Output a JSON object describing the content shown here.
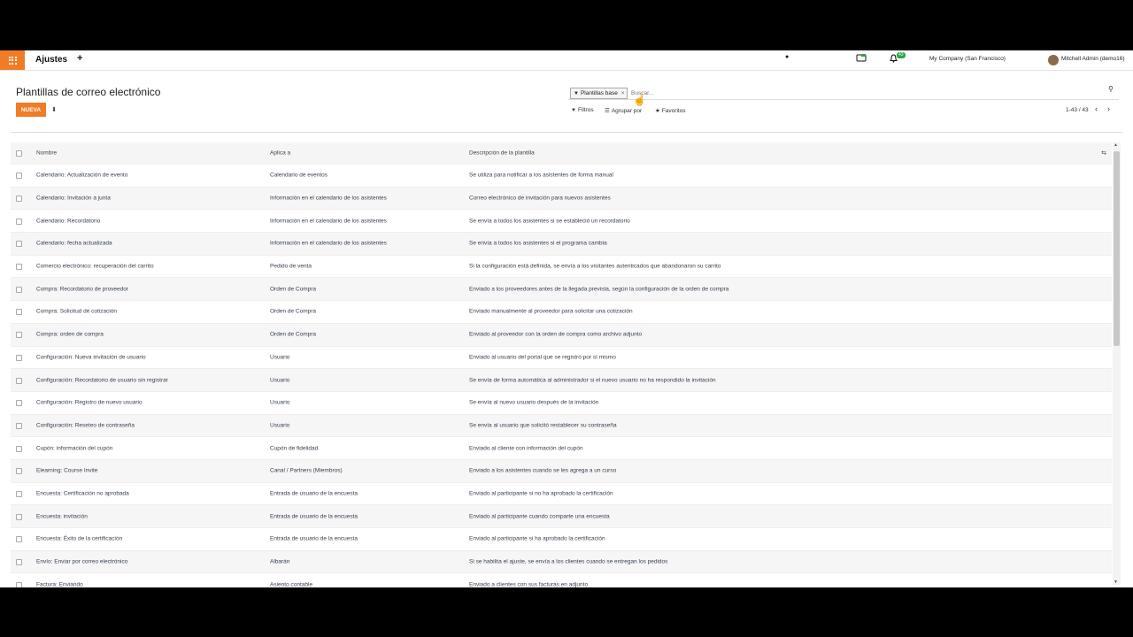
{
  "navbar": {
    "app_title": "Ajustes",
    "plus_label": "+",
    "messages_badge": "",
    "activity_badge": "43",
    "company": "My Company (San Francisco)",
    "user": "Mitchell Admin (demo16)"
  },
  "page": {
    "title": "Plantillas de correo electrónico",
    "new_button": "NUEVA"
  },
  "search": {
    "facet_label": "Plantillas base",
    "placeholder": "Buscar...",
    "filters": "Filtros",
    "group_by": "Agrupar por",
    "favorites": "Favoritos",
    "pager": "1-43 / 43"
  },
  "table": {
    "headers": [
      "Nombre",
      "Aplica a",
      "Descripción de la plantilla"
    ],
    "rows": [
      [
        "Calendario: Actualización de evento",
        "Calendario de eventos",
        "Se utiliza para notificar a los asistentes de forma manual"
      ],
      [
        "Calendario: Invitación a junta",
        "Información en el calendario de los asistentes",
        "Correo electrónico de invitación para nuevos asistentes"
      ],
      [
        "Calendario: Recordatorio",
        "Información en el calendario de los asistentes",
        "Se envía a todos los asistentes si se estableció un recordatorio"
      ],
      [
        "Calendario: fecha actualizada",
        "Información en el calendario de los asistentes",
        "Se envía a todos los asistentes si el programa cambia"
      ],
      [
        "Comercio electrónico: recuperación del carrito",
        "Pedido de venta",
        "Si la configuración está definida, se envía a los visitantes autenticados que abandonaron su carrito"
      ],
      [
        "Compra: Recordatorio de proveedor",
        "Orden de Compra",
        "Enviado a los proveedores antes de la llegada prevista, según la configuración de la orden de compra"
      ],
      [
        "Compra: Solicitud de cotización",
        "Orden de Compra",
        "Enviado manualmente al proveedor para solicitar una cotización"
      ],
      [
        "Compra: orden de compra",
        "Orden de Compra",
        "Enviado al proveedor con la orden de compra como archivo adjunto"
      ],
      [
        "Configuración: Nueva invitación de usuario",
        "Usuario",
        "Enviado al usuario del portal que se registró por sí mismo"
      ],
      [
        "Configuración: Recordatorio de usuario sin registrar",
        "Usuario",
        "Se envía de forma automática al administrador si el nuevo usuario no ha respondido la invitación"
      ],
      [
        "Configuración: Registro de nuevo usuario",
        "Usuario",
        "Se envía al nuevo usuario después de la invitación"
      ],
      [
        "Configuración: Reseteo de contraseña",
        "Usuario",
        "Se envía al usuario que solicitó restablecer su contraseña"
      ],
      [
        "Cupón: información del cupón",
        "Cupón de fidelidad",
        "Enviado al cliente con información del cupón"
      ],
      [
        "Elearning: Course Invite",
        "Canal / Partners (Miembros)",
        "Enviado a los asistentes cuando se les agrega a un curso"
      ],
      [
        "Encuesta: Certificación no aprobada",
        "Entrada de usuario de la encuesta",
        "Enviado al participante si no ha aprobado la certificación"
      ],
      [
        "Encuesta: invitación",
        "Entrada de usuario de la encuesta",
        "Enviado al participante cuando comparte una encuesta"
      ],
      [
        "Encuesta: Éxito de la certificación",
        "Entrada de usuario de la encuesta",
        "Enviado al participante si ha aprobado la certificación"
      ],
      [
        "Envío: Enviar por correo electrónico",
        "Albarán",
        "Si se habilita el ajuste, se envía a los clientes cuando se entregan los pedidos"
      ],
      [
        "Factura: Enviando",
        "Asiento contable",
        "Enviado a clientes con sus facturas en adjunto"
      ]
    ]
  }
}
